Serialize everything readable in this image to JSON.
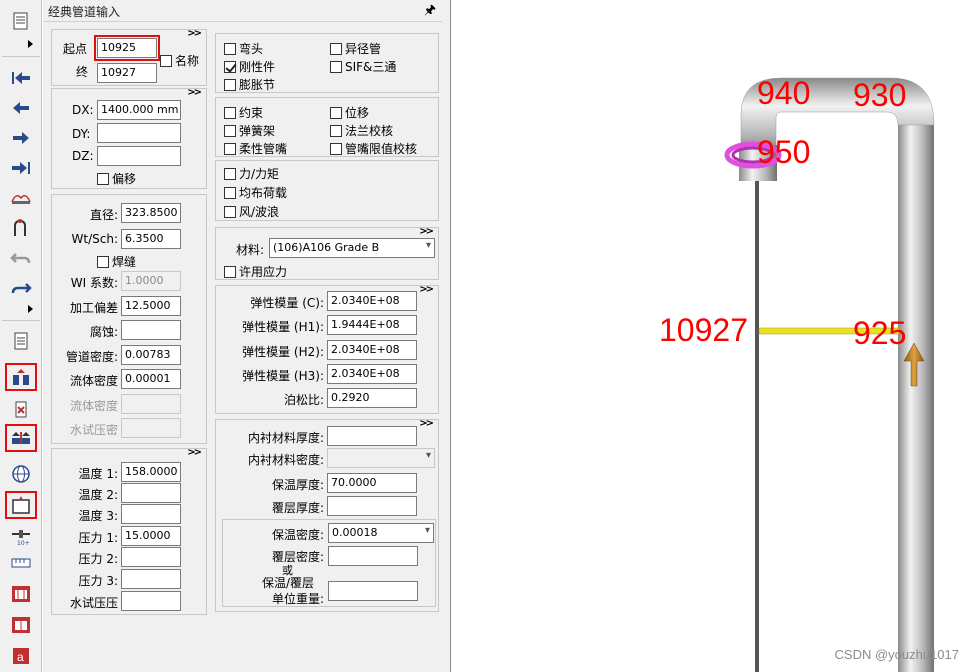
{
  "panel": {
    "title": "经典管道输入",
    "pin_icon": "pin-icon"
  },
  "nodes": {
    "from_label": "起点",
    "from_value": "10925",
    "to_label": "终",
    "to_value": "10927",
    "name_label": "名称"
  },
  "delta": {
    "dx_label": "DX:",
    "dx_value": "1400.000 mm",
    "dy_label": "DY:",
    "dy_value": "",
    "dz_label": "DZ:",
    "dz_value": "",
    "offset_label": "偏移"
  },
  "pipe": {
    "diameter_label": "直径:",
    "diameter_value": "323.8500",
    "wt_label": "Wt/Sch:",
    "wt_value": "6.3500",
    "weld_label": "焊缝",
    "wl_label": "WI 系数:",
    "wl_value": "1.0000",
    "tolerance_label": "加工偏差",
    "tolerance_value": "12.5000",
    "corrosion_label": "腐蚀:",
    "corrosion_value": "",
    "pipe_density_label": "管道密度:",
    "pipe_density_value": "0.00783",
    "fluid_density_label": "流体密度",
    "fluid_density_value": "0.00001",
    "fluid_density2_label": "流体密度",
    "hydro_pressure_label": "水试压密"
  },
  "conditions": {
    "t1_label": "温度 1:",
    "t1_value": "158.0000",
    "t2_label": "温度 2:",
    "t3_label": "温度 3:",
    "p1_label": "压力 1:",
    "p1_value": "15.0000",
    "p2_label": "压力 2:",
    "p3_label": "压力 3:",
    "hydro_label": "水试压压"
  },
  "element_types": [
    {
      "label": "弯头",
      "checked": false
    },
    {
      "label": "异径管",
      "checked": false
    },
    {
      "label": "刚性件",
      "checked": true
    },
    {
      "label": "SIF&三通",
      "checked": false
    },
    {
      "label": "膨胀节",
      "checked": false
    }
  ],
  "auxiliary": [
    {
      "label": "约束",
      "checked": false
    },
    {
      "label": "位移",
      "checked": false
    },
    {
      "label": "弹簧架",
      "checked": false
    },
    {
      "label": "法兰校核",
      "checked": false
    },
    {
      "label": "柔性管嘴",
      "checked": false
    },
    {
      "label": "管嘴限值校核",
      "checked": false
    }
  ],
  "loads": [
    {
      "label": "力/力矩",
      "checked": false
    },
    {
      "label": "均布荷载",
      "checked": false
    },
    {
      "label": "风/波浪",
      "checked": false
    }
  ],
  "material": {
    "label": "材料:",
    "value": "(106)A106 Grade B",
    "allowable_label": "许用应力"
  },
  "elastic": {
    "ec_label": "弹性模量 (C):",
    "ec_value": "2.0340E+08",
    "eh1_label": "弹性模量 (H1):",
    "eh1_value": "1.9444E+08",
    "eh2_label": "弹性模量 (H2):",
    "eh2_value": "2.0340E+08",
    "eh3_label": "弹性模量 (H3):",
    "eh3_value": "2.0340E+08",
    "poisson_label": "泊松比:",
    "poisson_value": "0.2920"
  },
  "lining": {
    "lining_thk_label": "内衬材料厚度:",
    "lining_den_label": "内衬材料密度:",
    "insul_thk_label": "保温厚度:",
    "insul_thk_value": "70.0000",
    "clad_thk_label": "覆层厚度:",
    "insul_den_label": "保温密度:",
    "insul_den_value": "0.00018",
    "clad_den_label": "覆层密度:",
    "or_label": "或",
    "unit_weight_label1": "保温/覆层",
    "unit_weight_label2": "单位重量:"
  },
  "viewport": {
    "labels": [
      "940",
      "930",
      "950",
      "10927",
      "925"
    ],
    "watermark": "CSDN @youzhu1017",
    "pipe_color": "#c0c0c0",
    "element_color": "#e8e020",
    "support_color": "#d09020",
    "flange_color": "#e050e0"
  },
  "toolbar_icons": [
    "list-icon",
    "first-icon",
    "prev-icon",
    "next-icon",
    "last-icon",
    "nodes-icon",
    "bend-icon",
    "undo-icon",
    "redo-icon",
    "document-icon",
    "exchange-icon",
    "delete-icon",
    "split-icon",
    "globe-icon",
    "insert-icon",
    "numbering-icon",
    "ruler-icon",
    "report-icon",
    "report2-icon",
    "text-icon"
  ]
}
